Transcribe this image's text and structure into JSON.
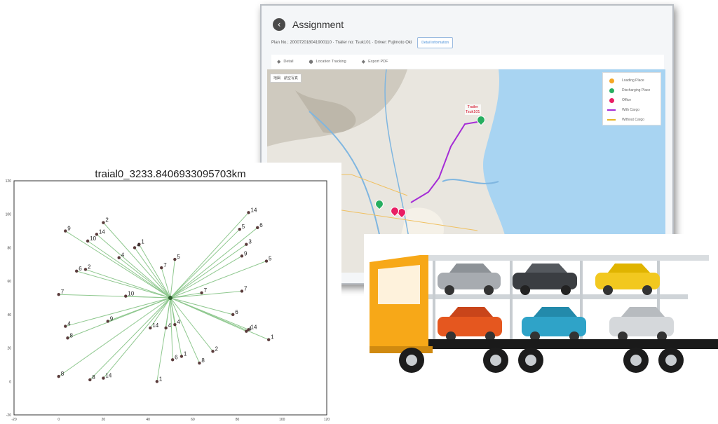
{
  "assignment": {
    "title": "Assignment",
    "back_icon": "chevron-left-icon",
    "plan_line": "Plan No.: 200072018041900110 · Trailer no: Tsuk101 · Driver: Fujimoto Oki",
    "detail_button": "Detail information",
    "tabs": [
      {
        "label": "Detail",
        "icon": "tag-icon"
      },
      {
        "label": "Location Tracking",
        "icon": "map-pin-icon"
      },
      {
        "label": "Export PDF",
        "icon": "tag-icon"
      }
    ],
    "map": {
      "map_type_button": "地図　航空写真",
      "trailer_label_line1": "Trailer",
      "trailer_label_line2": "Tsuk101",
      "legend": [
        {
          "label": "Loading Place",
          "color": "#f5a623",
          "kind": "dot"
        },
        {
          "label": "Discharging Place",
          "color": "#27ae60",
          "kind": "dot"
        },
        {
          "label": "Office",
          "color": "#e91e63",
          "kind": "dot"
        },
        {
          "label": "With Cargo",
          "color": "#a52cd6",
          "kind": "line"
        },
        {
          "label": "Without Cargo",
          "color": "#e6b422",
          "kind": "line"
        }
      ]
    }
  },
  "chart_data": {
    "type": "scatter",
    "title": "traial0_3233.8406933095703km",
    "xlim": [
      -20,
      120
    ],
    "ylim": [
      -20,
      120
    ],
    "x_ticks": [
      -20,
      0,
      20,
      40,
      60,
      80,
      100,
      120
    ],
    "y_ticks": [
      -20,
      0,
      20,
      40,
      60,
      80,
      100,
      120
    ],
    "hub": {
      "x": 50,
      "y": 50,
      "color": "#2e5e2e"
    },
    "edge_color": "#8fc88f",
    "points": [
      {
        "x": 20,
        "y": 95,
        "label": "2"
      },
      {
        "x": 3,
        "y": 90,
        "label": "9"
      },
      {
        "x": 17,
        "y": 88,
        "label": "14"
      },
      {
        "x": 13,
        "y": 84,
        "label": "10"
      },
      {
        "x": 36,
        "y": 82,
        "label": "1"
      },
      {
        "x": 34,
        "y": 80,
        "label": "4"
      },
      {
        "x": 27,
        "y": 74,
        "label": "4"
      },
      {
        "x": 46,
        "y": 68,
        "label": "7"
      },
      {
        "x": 52,
        "y": 73,
        "label": "5"
      },
      {
        "x": 12,
        "y": 67,
        "label": "2"
      },
      {
        "x": 8,
        "y": 66,
        "label": "6"
      },
      {
        "x": 0,
        "y": 52,
        "label": "7"
      },
      {
        "x": 30,
        "y": 51,
        "label": "10"
      },
      {
        "x": 85,
        "y": 101,
        "label": "14"
      },
      {
        "x": 89,
        "y": 92,
        "label": "6"
      },
      {
        "x": 81,
        "y": 91,
        "label": "5"
      },
      {
        "x": 84,
        "y": 82,
        "label": "3"
      },
      {
        "x": 82,
        "y": 75,
        "label": "9"
      },
      {
        "x": 93,
        "y": 72,
        "label": "5"
      },
      {
        "x": 64,
        "y": 53,
        "label": "7"
      },
      {
        "x": 82,
        "y": 54,
        "label": "7"
      },
      {
        "x": 78,
        "y": 40,
        "label": "6"
      },
      {
        "x": 85,
        "y": 31,
        "label": "14"
      },
      {
        "x": 84,
        "y": 30,
        "label": "4"
      },
      {
        "x": 94,
        "y": 25,
        "label": "1"
      },
      {
        "x": 22,
        "y": 36,
        "label": "9"
      },
      {
        "x": 3,
        "y": 33,
        "label": "4"
      },
      {
        "x": 4,
        "y": 26,
        "label": "8"
      },
      {
        "x": 41,
        "y": 32,
        "label": "14"
      },
      {
        "x": 48,
        "y": 32,
        "label": "4"
      },
      {
        "x": 52,
        "y": 34,
        "label": "4"
      },
      {
        "x": 69,
        "y": 18,
        "label": "2"
      },
      {
        "x": 55,
        "y": 15,
        "label": "1"
      },
      {
        "x": 51,
        "y": 13,
        "label": "6"
      },
      {
        "x": 63,
        "y": 11,
        "label": "8"
      },
      {
        "x": 0,
        "y": 3,
        "label": "8"
      },
      {
        "x": 14,
        "y": 1,
        "label": "8"
      },
      {
        "x": 20,
        "y": 2,
        "label": "14"
      },
      {
        "x": 44,
        "y": 0,
        "label": "1"
      }
    ]
  }
}
